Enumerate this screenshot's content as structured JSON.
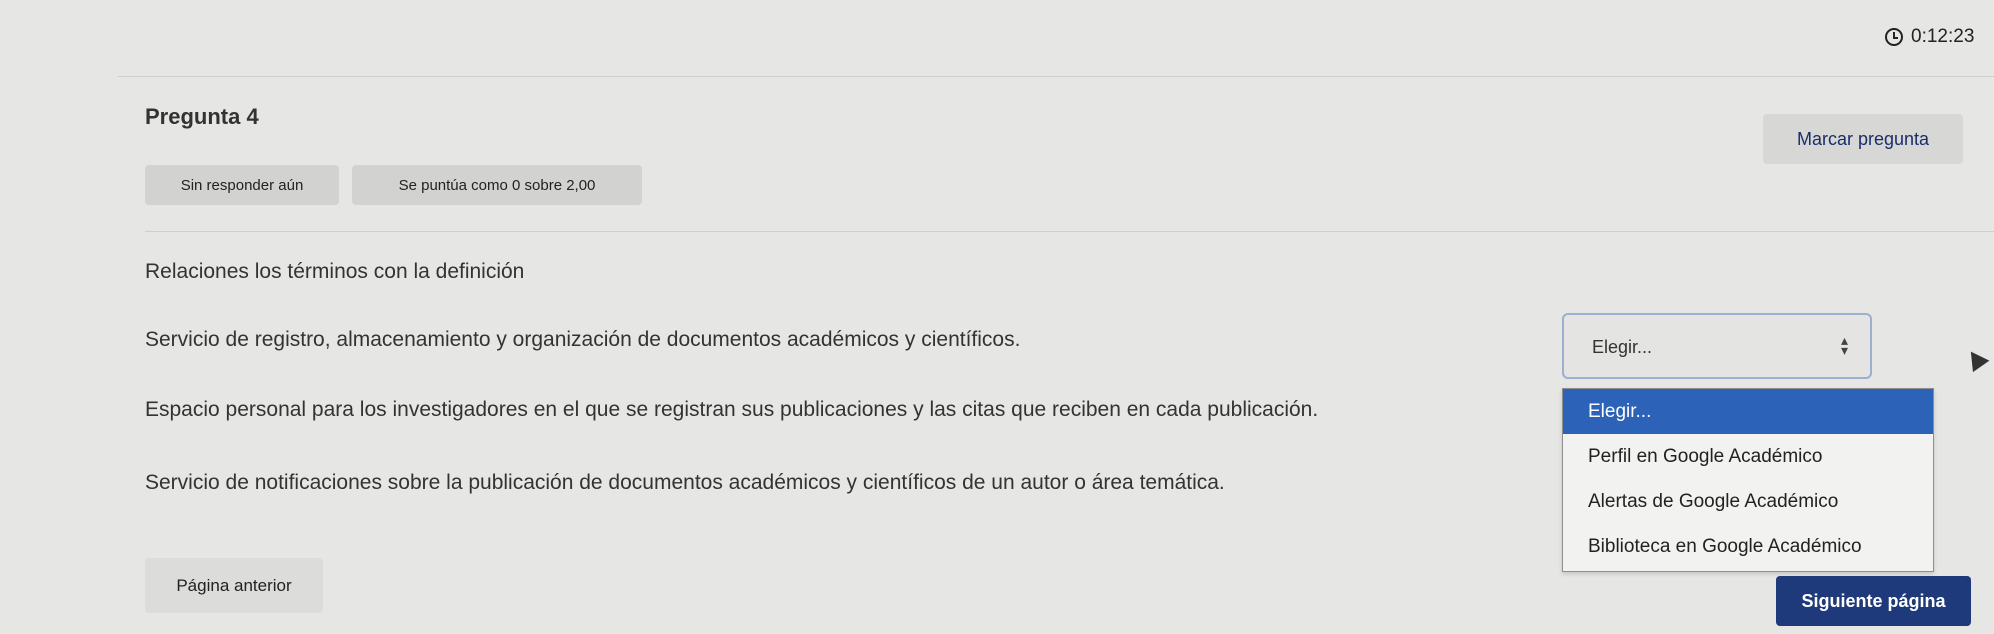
{
  "timer": {
    "value": "0:12:23",
    "icon": "clock-icon"
  },
  "question": {
    "title": "Pregunta 4",
    "flag_label": "Marcar pregunta",
    "status": "Sin responder aún",
    "grade": "Se puntúa como 0 sobre 2,00",
    "prompt": "Relaciones los términos con la definición"
  },
  "stems": [
    "Servicio de registro, almacenamiento y organización de documentos académicos y científicos.",
    "Espacio personal para los investigadores en el que se registran sus publicaciones y las citas que reciben en cada publicación.",
    "Servicio de notificaciones sobre la publicación de documentos académicos y científicos de un autor o área temática."
  ],
  "select": {
    "current_value": "Elegir...",
    "options": [
      "Elegir...",
      "Perfil en Google Académico",
      "Alertas de Google Académico",
      "Biblioteca en Google Académico"
    ],
    "highlighted_option": "Elegir..."
  },
  "nav": {
    "prev_label": "Página anterior",
    "next_label": "Siguiente página"
  },
  "colors": {
    "accent": "#2c62b8",
    "primary_button": "#1f3a7a",
    "link_text": "#1a2d6b"
  }
}
